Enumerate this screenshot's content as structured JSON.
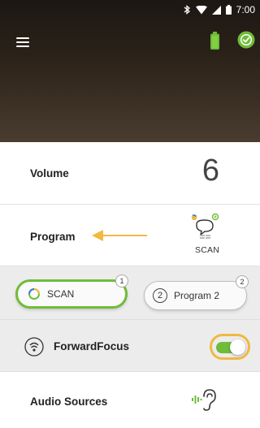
{
  "status_bar": {
    "time": "7:00",
    "icons": [
      "bluetooth-icon",
      "wifi-icon",
      "signal-icon",
      "battery-icon"
    ]
  },
  "app_bar": {
    "icons": [
      "menu-icon",
      "device-battery-icon",
      "connected-check-icon"
    ],
    "accent_green": "#6fbc3a"
  },
  "volume": {
    "label": "Volume",
    "value": "6"
  },
  "program": {
    "label": "Program",
    "current_name": "SCAN",
    "icon": "scan-program-icon"
  },
  "programs": [
    {
      "label": "SCAN",
      "badge": "1",
      "active": true
    },
    {
      "label": "Program 2",
      "number": "2",
      "badge": "2",
      "active": false
    }
  ],
  "forward_focus": {
    "label": "ForwardFocus",
    "enabled": true,
    "icon": "forward-focus-icon"
  },
  "audio_sources": {
    "label": "Audio Sources",
    "icon": "audio-ear-icon"
  },
  "colors": {
    "highlight": "#f2b841",
    "active": "#6fbc3a"
  }
}
